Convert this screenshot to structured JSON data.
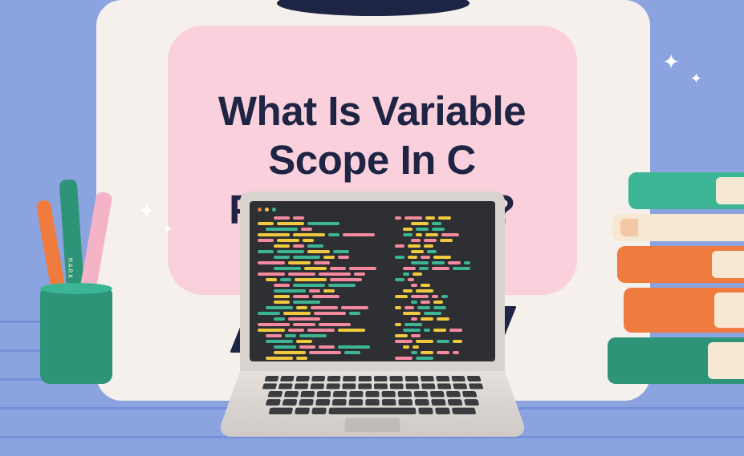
{
  "title": {
    "text": "What Is Variable Scope In C Programming?"
  },
  "pen_label": "MARK",
  "colors": {
    "background": "#8ba4e0",
    "title_card": "#f9d0dc",
    "title_text": "#1e2444",
    "accent_green": "#2d9478",
    "accent_orange": "#f07b3f",
    "accent_pink": "#f5b3c7",
    "cream": "#f7e8d3"
  }
}
